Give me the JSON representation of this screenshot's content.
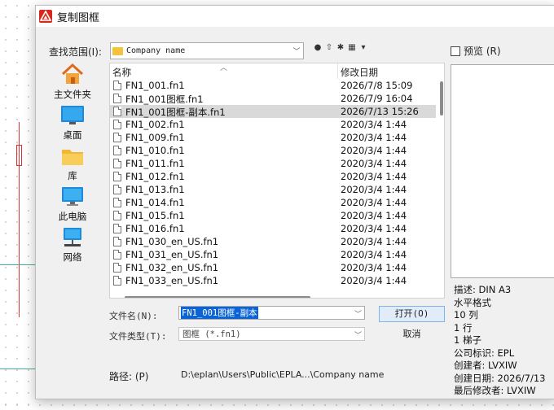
{
  "dialog": {
    "title": "复制图框",
    "look_in_label": "查找范围(I):",
    "look_in_value": "Company name",
    "preview_label": "预览 (R)"
  },
  "places": [
    {
      "label": "主文件夹",
      "icon": "home-icon"
    },
    {
      "label": "桌面",
      "icon": "desktop-icon"
    },
    {
      "label": "库",
      "icon": "library-folder-icon"
    },
    {
      "label": "此电脑",
      "icon": "computer-icon"
    },
    {
      "label": "网络",
      "icon": "network-icon"
    }
  ],
  "list": {
    "col_name": "名称",
    "col_date": "修改日期",
    "files": [
      {
        "name": "FN1_001.fn1",
        "date": "2026/7/8 15:09"
      },
      {
        "name": "FN1_001图框.fn1",
        "date": "2026/7/9 16:04"
      },
      {
        "name": "FN1_001图框-副本.fn1",
        "date": "2026/7/13 15:26"
      },
      {
        "name": "FN1_002.fn1",
        "date": "2020/3/4 1:44"
      },
      {
        "name": "FN1_009.fn1",
        "date": "2020/3/4 1:44"
      },
      {
        "name": "FN1_010.fn1",
        "date": "2020/3/4 1:44"
      },
      {
        "name": "FN1_011.fn1",
        "date": "2020/3/4 1:44"
      },
      {
        "name": "FN1_012.fn1",
        "date": "2020/3/4 1:44"
      },
      {
        "name": "FN1_013.fn1",
        "date": "2020/3/4 1:44"
      },
      {
        "name": "FN1_014.fn1",
        "date": "2020/3/4 1:44"
      },
      {
        "name": "FN1_015.fn1",
        "date": "2020/3/4 1:44"
      },
      {
        "name": "FN1_016.fn1",
        "date": "2020/3/4 1:44"
      },
      {
        "name": "FN1_030_en_US.fn1",
        "date": "2020/3/4 1:44"
      },
      {
        "name": "FN1_031_en_US.fn1",
        "date": "2020/3/4 1:44"
      },
      {
        "name": "FN1_032_en_US.fn1",
        "date": "2020/3/4 1:44"
      },
      {
        "name": "FN1_033_en_US.fn1",
        "date": "2020/3/4 1:44"
      }
    ]
  },
  "form": {
    "filename_label": "文件名(N):",
    "filename_value": "FN1_001图框-副本",
    "filetype_label": "文件类型(T):",
    "filetype_value": "图框 (*.fn1)",
    "open_button": "打开(O)",
    "cancel_button": "取消",
    "path_label": "路径: (P)",
    "path_value": "D:\\eplan\\Users\\Public\\EPLA...\\Company name"
  },
  "details": [
    "描述: DIN A3",
    "水平格式",
    "10 列",
    "1 行",
    "1 梯子",
    "公司标识: EPL",
    "创建者: LVXIW",
    "创建日期: 2026/7/13",
    "最后修改者: LVXIW"
  ]
}
